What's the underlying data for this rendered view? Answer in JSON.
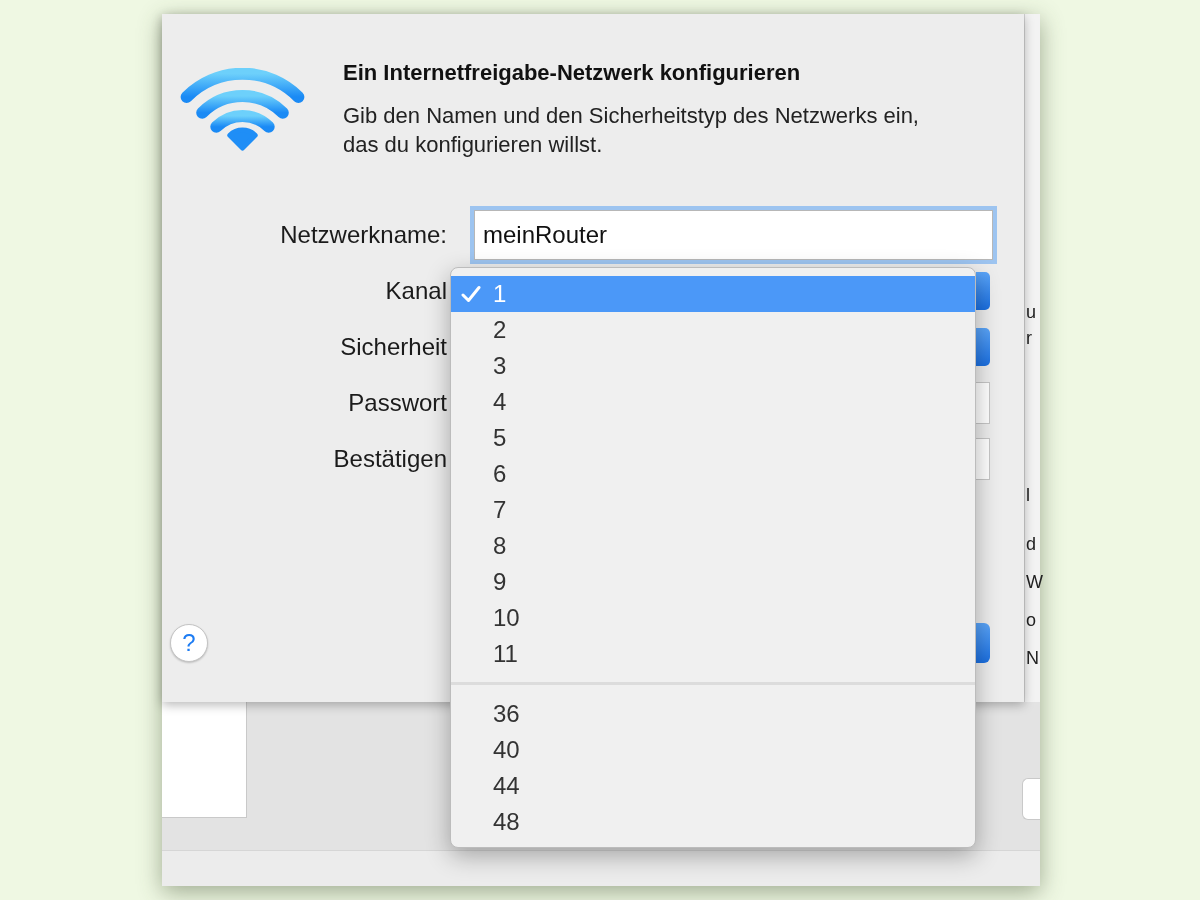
{
  "dialog": {
    "title": "Ein Internetfreigabe-Netzwerk konfigurieren",
    "description": "Gib den Namen und den Sicherheitstyp des Netzwerks ein, das du konfigurieren willst.",
    "fields": [
      {
        "kind": "text",
        "label": "Netzwerkname:",
        "value": "meinRouter",
        "focused": true
      },
      {
        "kind": "popup",
        "label": "Kanal",
        "focused": false
      },
      {
        "kind": "popup",
        "label": "Sicherheit",
        "focused": false
      },
      {
        "kind": "secure",
        "label": "Passwort",
        "focused": false
      },
      {
        "kind": "secure",
        "label": "Bestätigen",
        "focused": false
      }
    ],
    "help_button": {
      "label": "?"
    }
  },
  "channel_menu": {
    "groups": [
      {
        "items": [
          {
            "label": "1",
            "selected": true,
            "checked": true
          },
          {
            "label": "2",
            "selected": false,
            "checked": false
          },
          {
            "label": "3",
            "selected": false,
            "checked": false
          },
          {
            "label": "4",
            "selected": false,
            "checked": false
          },
          {
            "label": "5",
            "selected": false,
            "checked": false
          },
          {
            "label": "6",
            "selected": false,
            "checked": false
          },
          {
            "label": "7",
            "selected": false,
            "checked": false
          },
          {
            "label": "8",
            "selected": false,
            "checked": false
          },
          {
            "label": "9",
            "selected": false,
            "checked": false
          },
          {
            "label": "10",
            "selected": false,
            "checked": false
          },
          {
            "label": "11",
            "selected": false,
            "checked": false
          }
        ]
      },
      {
        "items": [
          {
            "label": "36",
            "selected": false,
            "checked": false
          },
          {
            "label": "40",
            "selected": false,
            "checked": false
          },
          {
            "label": "44",
            "selected": false,
            "checked": false
          },
          {
            "label": "48",
            "selected": false,
            "checked": false
          }
        ]
      }
    ]
  },
  "background_window": {
    "text_fragments": [
      [
        "u",
        "r"
      ],
      [
        "l"
      ],
      [
        "d",
        "W",
        "o",
        "N"
      ]
    ]
  }
}
